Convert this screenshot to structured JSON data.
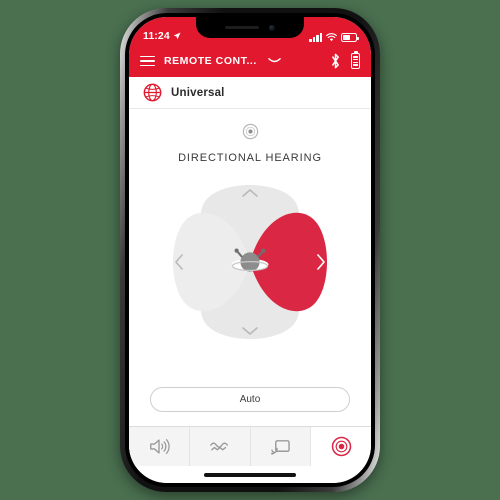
{
  "device": {
    "status_bar": {
      "time": "11:24",
      "location_icon": "location-arrow-icon",
      "signal_icon": "cellular-signal-icon",
      "wifi_icon": "wifi-icon",
      "battery_icon": "battery-icon"
    },
    "home_indicator": "home-indicator"
  },
  "app_bar": {
    "menu_icon": "hamburger-menu-icon",
    "title": "REMOTE CONT...",
    "chevron_icon": "chevron-down-icon",
    "bluetooth_icon": "bluetooth-icon",
    "device_battery_icon": "hearing-aid-battery-icon",
    "background_color": "#e2182f"
  },
  "program": {
    "icon": "globe-icon",
    "name": "Universal",
    "icon_color": "#e2182f"
  },
  "main": {
    "feature_icon": "directional-target-icon",
    "title": "DIRECTIONAL HEARING",
    "center_icon": "head-with-hearing-aids-icon",
    "directions": [
      {
        "id": "front",
        "label": "chevron-up-icon",
        "selected": false
      },
      {
        "id": "right",
        "label": "chevron-right-icon",
        "selected": true
      },
      {
        "id": "back",
        "label": "chevron-down-icon",
        "selected": false
      },
      {
        "id": "left",
        "label": "chevron-left-icon",
        "selected": false
      }
    ],
    "selected_direction": "right",
    "auto_button_label": "Auto",
    "accent_color": "#d92744",
    "inactive_color": "#e6e6e6"
  },
  "tabs": [
    {
      "id": "volume",
      "icon": "speaker-volume-icon",
      "active": false
    },
    {
      "id": "sound",
      "icon": "sound-waves-icon",
      "active": false
    },
    {
      "id": "streaming",
      "icon": "cast-streaming-icon",
      "active": false
    },
    {
      "id": "direction",
      "icon": "target-record-icon",
      "active": true
    }
  ],
  "colors": {
    "background": "#4a7050",
    "brand_red": "#e2182f",
    "accent_red": "#d92744"
  }
}
